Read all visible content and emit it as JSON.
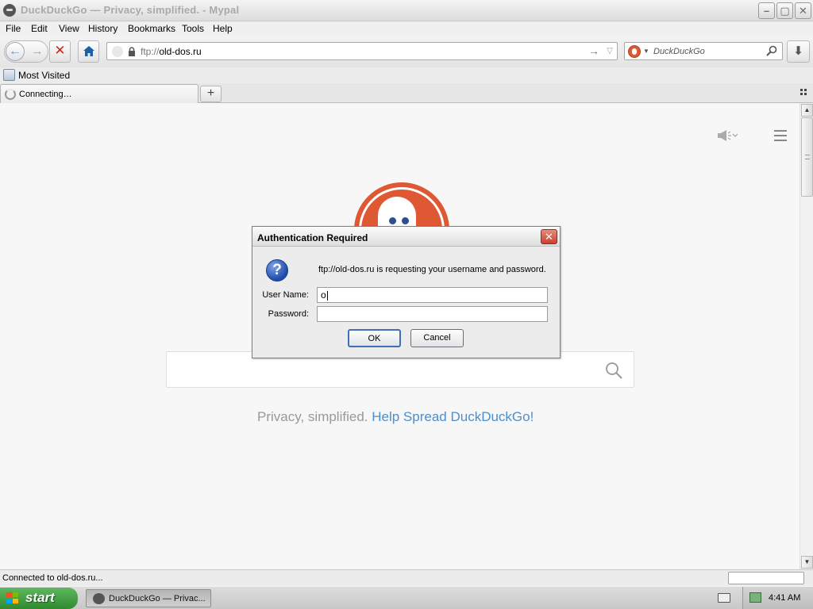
{
  "window": {
    "title": "DuckDuckGo — Privacy, simplified. - Mypal",
    "min_glyph": "–",
    "max_glyph": "▢",
    "close_glyph": "✕"
  },
  "menu": {
    "items": [
      "File",
      "Edit",
      "View",
      "History",
      "Bookmarks",
      "Tools",
      "Help"
    ]
  },
  "navbar": {
    "back_glyph": "←",
    "forward_glyph": "→",
    "stop_glyph": "✕",
    "url_protocol": "ftp://",
    "url_host": "old-dos.ru",
    "go_glyph": "→",
    "url_dropdown_glyph": "▽",
    "search_engine_dropdown_glyph": "▼",
    "search_placeholder": "DuckDuckGo",
    "download_glyph": "⬇"
  },
  "bookmarks": {
    "items": [
      {
        "label": "Most Visited",
        "icon": "bookmarks-folder-icon"
      }
    ]
  },
  "tabs": {
    "items": [
      {
        "label": "Connecting…",
        "state": "loading"
      }
    ],
    "new_tab_glyph": "+"
  },
  "page": {
    "tagline_static": "Privacy, simplified.",
    "tagline_link": "Help Spread DuckDuckGo!",
    "search_placeholder": ""
  },
  "dialog": {
    "title": "Authentication Required",
    "close_glyph": "✕",
    "question_glyph": "?",
    "message": "ftp://old-dos.ru is requesting your username and password.",
    "username_label": "User Name:",
    "username_value": "o",
    "password_label": "Password:",
    "password_value": "",
    "ok_label": "OK",
    "cancel_label": "Cancel"
  },
  "statusbar": {
    "text": "Connected to old-dos.ru..."
  },
  "taskbar": {
    "start_label": "start",
    "task_label": "DuckDuckGo — Privac...",
    "clock": "4:41 AM"
  },
  "colors": {
    "ddg_orange": "#de5833",
    "link_blue": "#4e8ecb",
    "tagline_grey": "#999999",
    "start_green": "#3c9a3c",
    "stop_red": "#c62a1f"
  }
}
